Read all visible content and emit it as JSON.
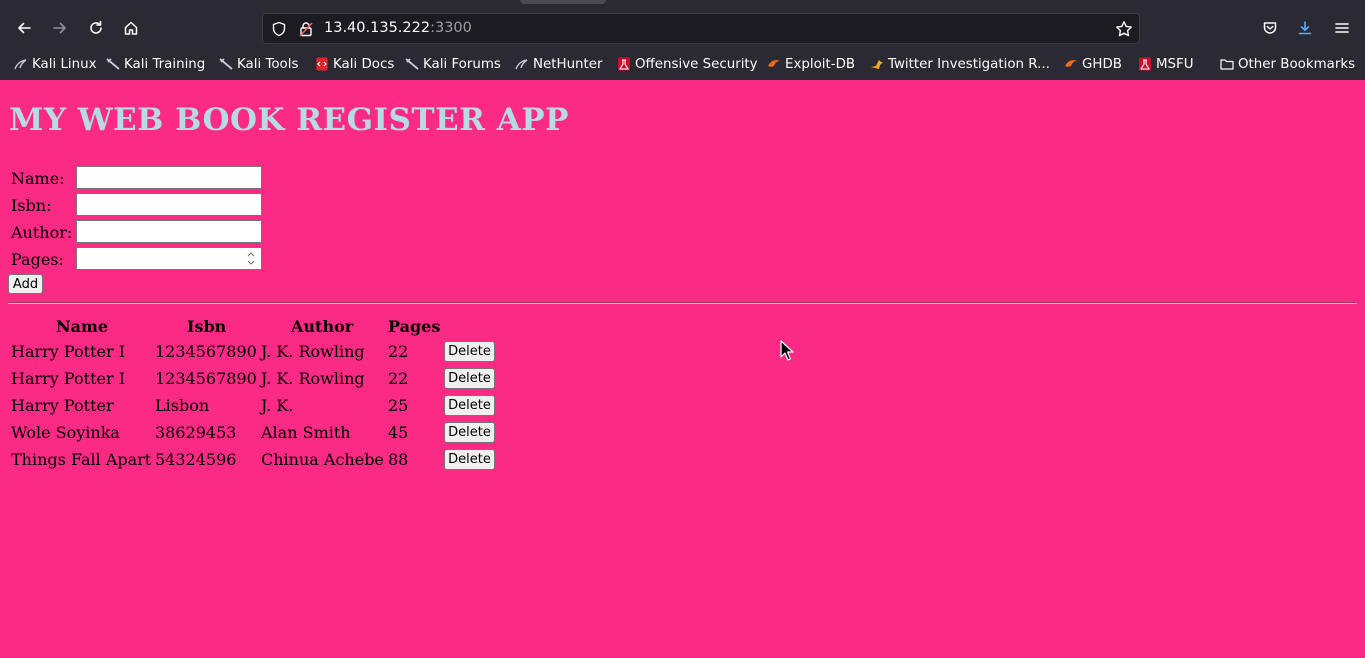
{
  "browser": {
    "url_host": "13.40.135.222",
    "url_port": ":3300",
    "bookmarks": [
      {
        "label": "Kali Linux",
        "icon": "kali-dragon-icon"
      },
      {
        "label": "Kali Training",
        "icon": "kali-sword-icon"
      },
      {
        "label": "Kali Tools",
        "icon": "kali-sword-icon"
      },
      {
        "label": "Kali Docs",
        "icon": "kali-docs-icon"
      },
      {
        "label": "Kali Forums",
        "icon": "kali-sword-icon"
      },
      {
        "label": "NetHunter",
        "icon": "kali-dragon-icon"
      },
      {
        "label": "Offensive Security",
        "icon": "offsec-icon"
      },
      {
        "label": "Exploit-DB",
        "icon": "exploitdb-icon"
      },
      {
        "label": "Twitter Investigation R...",
        "icon": "twitter-investigation-icon"
      },
      {
        "label": "GHDB",
        "icon": "exploitdb-icon"
      },
      {
        "label": "MSFU",
        "icon": "offsec-icon"
      }
    ],
    "other_bookmarks": "Other Bookmarks"
  },
  "app": {
    "title": "MY WEB BOOK REGISTER APP",
    "form": {
      "name_label": "Name:",
      "isbn_label": "Isbn:",
      "author_label": "Author:",
      "pages_label": "Pages:",
      "name_value": "",
      "isbn_value": "",
      "author_value": "",
      "pages_value": "",
      "add_label": "Add"
    },
    "table": {
      "headers": [
        "Name",
        "Isbn",
        "Author",
        "Pages"
      ],
      "rows": [
        {
          "name": "Harry Potter I",
          "isbn": "1234567890",
          "author": "J. K. Rowling",
          "pages": "22"
        },
        {
          "name": "Harry Potter I",
          "isbn": "1234567890",
          "author": "J. K. Rowling",
          "pages": "22"
        },
        {
          "name": "Harry Potter",
          "isbn": "Lisbon",
          "author": "J. K.",
          "pages": "25"
        },
        {
          "name": "Wole Soyinka",
          "isbn": "38629453",
          "author": "Alan Smith",
          "pages": "45"
        },
        {
          "name": "Things Fall Apart",
          "isbn": "54324596",
          "author": "Chinua Achebe",
          "pages": "88"
        }
      ],
      "delete_label": "Delete"
    }
  },
  "colors": {
    "page_background": "#fb2b85",
    "title_color": "#b6dbe2",
    "chrome_background": "#2b2a33"
  }
}
